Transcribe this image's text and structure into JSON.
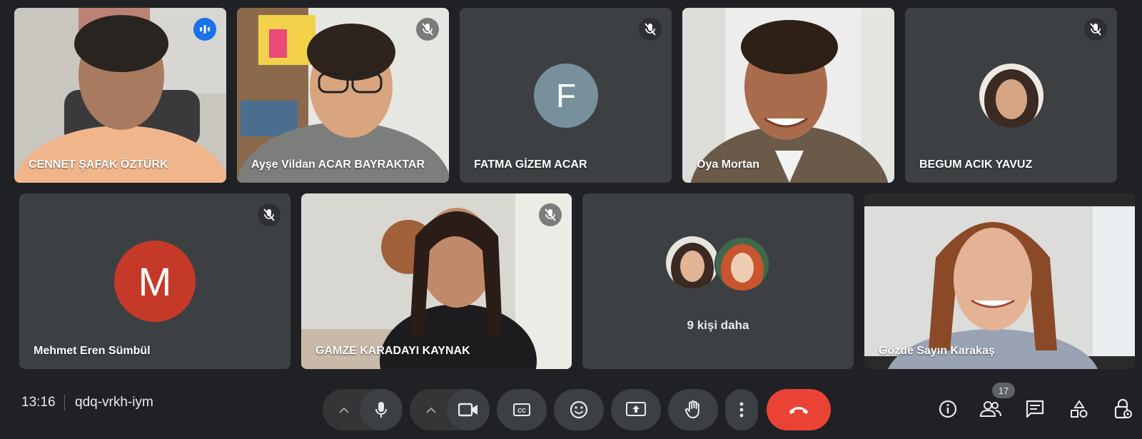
{
  "meeting": {
    "time": "13:16",
    "code": "qdq-vrkh-iym",
    "participant_count": "17"
  },
  "participants": [
    {
      "name": "CENNET ŞAFAK ÖZTÜRK",
      "state": "speaking",
      "video": true
    },
    {
      "name": "Ayşe Vildan ACAR BAYRAKTAR",
      "state": "muted",
      "video": true
    },
    {
      "name": "FATMA GİZEM ACAR",
      "state": "muted",
      "video": false,
      "avatar_letter": "F",
      "avatar_color": "#78909c"
    },
    {
      "name": "Oya Mortan",
      "state": "unmuted",
      "video": true
    },
    {
      "name": "BEGUM ACIK YAVUZ",
      "state": "muted",
      "video": false,
      "avatar": "photo"
    },
    {
      "name": "Mehmet Eren Sümbül",
      "state": "muted",
      "video": false,
      "avatar_letter": "M",
      "avatar_color": "#c53929"
    },
    {
      "name": "GAMZE KARADAYI KAYNAK",
      "state": "muted",
      "video": true
    },
    {
      "name": "Gözde Sayın Karakaş",
      "state": "unmuted",
      "video": true
    }
  ],
  "others_tile": {
    "label": "9 kişi daha"
  },
  "controls": {
    "icons": [
      "chevron-up-icon",
      "microphone-icon",
      "chevron-up-icon",
      "camera-icon",
      "captions-icon",
      "emoji-icon",
      "present-screen-icon",
      "raise-hand-icon",
      "more-options-icon",
      "hang-up-icon"
    ],
    "right_icons": [
      "info-icon",
      "people-icon",
      "chat-icon",
      "activities-icon",
      "host-controls-icon"
    ]
  },
  "colors": {
    "background": "#202124",
    "tile": "#3c4043",
    "accent": "#1a73e8",
    "hangup": "#ea4335"
  }
}
